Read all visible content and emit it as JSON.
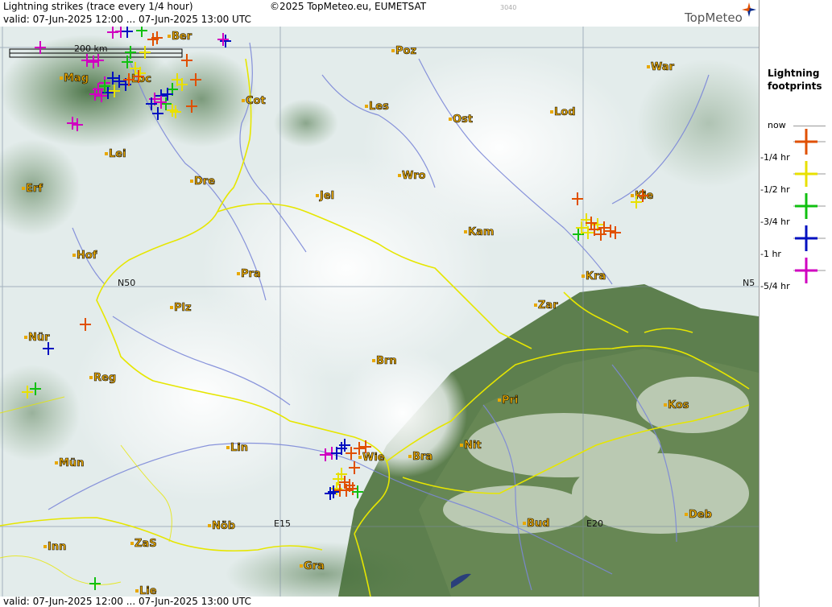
{
  "header": {
    "title": "Lightning strikes (trace every 1/4 hour)",
    "copyright": "©2025 TopMeteo.eu, EUMETSAT",
    "valid": "valid:  07-Jun-2025 12:00 ... 07-Jun-2025 13:00 UTC",
    "code": "3040",
    "brand": "TopMeteo"
  },
  "footer": {
    "valid": "valid:  07-Jun-2025 12:00 ... 07-Jun-2025 13:00 UTC"
  },
  "scale": {
    "label": "200 km"
  },
  "grid_labels": {
    "n50": "N50",
    "n50_right": "N5",
    "e15": "E15",
    "e20": "E20"
  },
  "cities": [
    "Ber",
    "Poz",
    "War",
    "Mag",
    "Loc",
    "Cot",
    "Les",
    "Ost",
    "Lod",
    "Lei",
    "Erf",
    "Dre",
    "Wro",
    "Jel",
    "Kie",
    "Kam",
    "Hof",
    "Pra",
    "Kra",
    "Plz",
    "Zar",
    "Nür",
    "Brn",
    "Reg",
    "Pri",
    "Kos",
    "Nit",
    "Wie",
    "Bra",
    "Lin",
    "Mün",
    "Bud",
    "Deb",
    "Nöb",
    "Inn",
    "ZaS",
    "Gra",
    "Lie"
  ],
  "legend": {
    "title_line1": "Lightning",
    "title_line2": "footprints",
    "entries": [
      {
        "label": "now",
        "color": "#e05000"
      },
      {
        "label": "-1/4 hr",
        "color": "#e05000"
      },
      {
        "label": "-1/2 hr",
        "color": "#e8e000"
      },
      {
        "label": "-3/4 hr",
        "color": "#10c010"
      },
      {
        "label": "-1 hr",
        "color": "#0010c0"
      },
      {
        "label": "-5/4 hr",
        "color": "#d000c0"
      }
    ]
  },
  "colors": {
    "orange": "#e05000",
    "yellow": "#e8e000",
    "green": "#10c010",
    "blue": "#0010c0",
    "magenta": "#d000c0",
    "city_label": "#e8a800",
    "border": "#e6e600",
    "river": "#7c88d8"
  }
}
